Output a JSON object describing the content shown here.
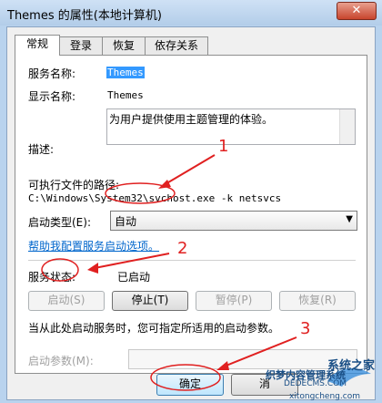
{
  "window": {
    "title": "Themes 的属性(本地计算机)",
    "close": "✕"
  },
  "tabs": [
    "常规",
    "登录",
    "恢复",
    "依存关系"
  ],
  "general": {
    "service_name_label": "服务名称:",
    "service_name_value": "Themes",
    "display_name_label": "显示名称:",
    "display_name_value": "Themes",
    "description_label": "描述:",
    "description_value": "为用户提供使用主题管理的体验。",
    "exe_path_label": "可执行文件的路径:",
    "exe_path_value": "C:\\Windows\\System32\\svchost.exe -k netsvcs",
    "startup_type_label": "启动类型(E):",
    "startup_type_value": "自动",
    "help_link": "帮助我配置服务启动选项。",
    "status_label": "服务状态:",
    "status_value": "已启动",
    "btn_start": "启动(S)",
    "btn_stop": "停止(T)",
    "btn_pause": "暂停(P)",
    "btn_resume": "恢复(R)",
    "note": "当从此处启动服务时，您可指定所适用的启动参数。",
    "param_label": "启动参数(M):",
    "param_value": ""
  },
  "footer": {
    "ok": "确定",
    "cancel": "消"
  },
  "annotations": {
    "n1": "1",
    "n2": "2",
    "n3": "3"
  },
  "watermark": {
    "line1": "系统之家",
    "line2": "xitongcheng.com",
    "line3": "织梦内容管理系统",
    "line4": "DEDECMS.COM"
  }
}
